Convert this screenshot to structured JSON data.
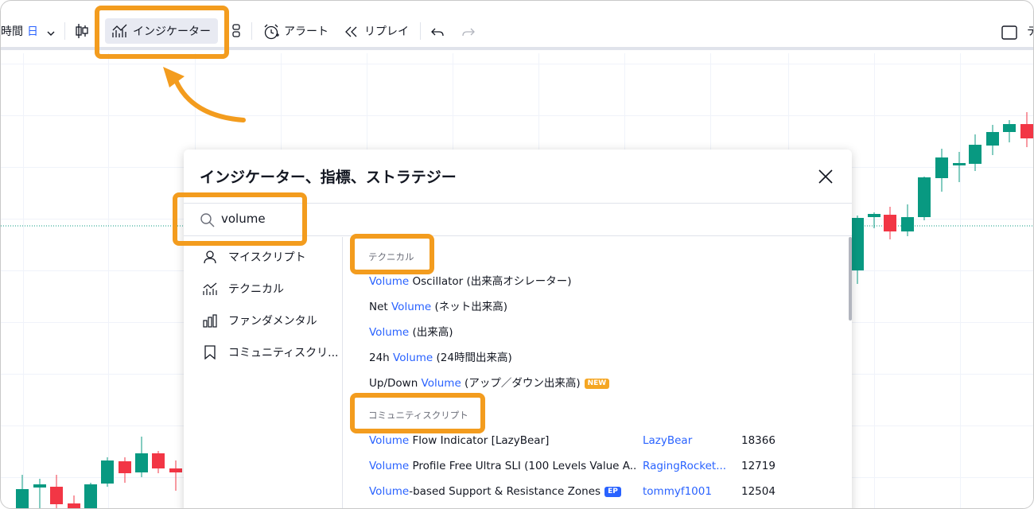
{
  "toolbar": {
    "timeframe_prefix": "時間",
    "timeframe_value": "日",
    "indicators_label": "インジケーター",
    "alert_label": "アラート",
    "replay_label": "リプレイ",
    "right_cut_label": "テ"
  },
  "dialog": {
    "title": "インジケーター、指標、ストラテジー",
    "search_value": "volume",
    "sidebar": [
      {
        "label": "マイスクリプト",
        "icon": "user-icon"
      },
      {
        "label": "テクニカル",
        "icon": "chart-line-icon"
      },
      {
        "label": "ファンダメンタル",
        "icon": "bar-chart-icon"
      },
      {
        "label": "コミュニティスクリ...",
        "icon": "bookmark-icon"
      }
    ],
    "sections": {
      "technical": "テクニカル",
      "community": "コミュニティスクリプト"
    },
    "technical_results": [
      {
        "hl": "Volume",
        "rest": " Oscillator (出来高オシレーター)"
      },
      {
        "pre": "Net ",
        "hl": "Volume",
        "rest": " (ネット出来高)"
      },
      {
        "hl": "Volume",
        "rest": " (出来高)"
      },
      {
        "pre": "24h ",
        "hl": "Volume",
        "rest": " (24時間出来高)"
      },
      {
        "pre": "Up/Down ",
        "hl": "Volume",
        "rest": " (アップ／ダウン出来高)",
        "badge": "NEW"
      }
    ],
    "community_results": [
      {
        "hl": "Volume",
        "rest": " Flow Indicator [LazyBear]",
        "author": "LazyBear",
        "count": "18366"
      },
      {
        "hl": "Volume",
        "rest": " Profile Free Ultra SLI (100 Levels Value A...",
        "author": "RagingRocket...",
        "count": "12719"
      },
      {
        "hl": "Volume",
        "rest": "-based Support & Resistance Zones",
        "badge": "EP",
        "author": "tommyf1001",
        "count": "12504"
      }
    ]
  },
  "colors": {
    "annotation": "#f39c1e",
    "up": "#089981",
    "down": "#f23645",
    "link": "#2962ff"
  }
}
